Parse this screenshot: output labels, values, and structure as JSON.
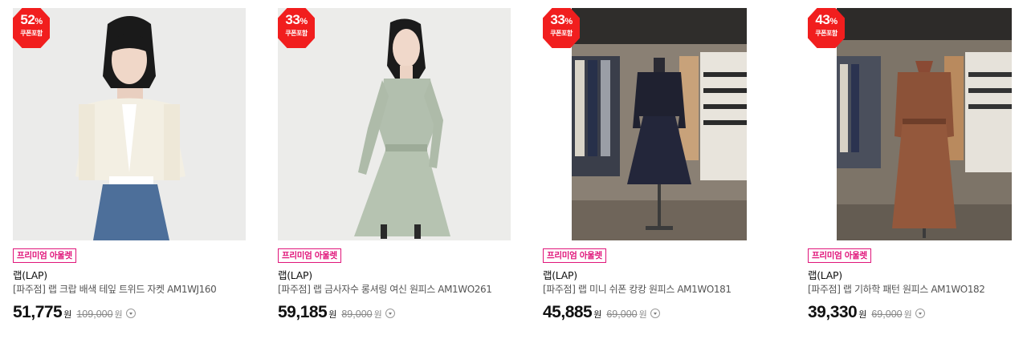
{
  "products": [
    {
      "discount_pct": "52",
      "discount_unit": "%",
      "coupon_label": "쿠폰포함",
      "badge": "프리미엄 아울렛",
      "brand": "랩(LAP)",
      "name": "[파주점] 랩 크랍 배색 테잎 트위드 자켓 AM1WJ160",
      "price": "51,775",
      "currency": "원",
      "original_price": "109,000",
      "original_currency": "원"
    },
    {
      "discount_pct": "33",
      "discount_unit": "%",
      "coupon_label": "쿠폰포함",
      "badge": "프리미엄 아울렛",
      "brand": "랩(LAP)",
      "name": "[파주점] 랩 금사자수 롱셔링 여신 원피스 AM1WO261",
      "price": "59,185",
      "currency": "원",
      "original_price": "89,000",
      "original_currency": "원"
    },
    {
      "discount_pct": "33",
      "discount_unit": "%",
      "coupon_label": "쿠폰포함",
      "badge": "프리미엄 아울렛",
      "brand": "랩(LAP)",
      "name": "[파주점] 랩 미니 쉬폰 캉캉 원피스 AM1WO181",
      "price": "45,885",
      "currency": "원",
      "original_price": "69,000",
      "original_currency": "원"
    },
    {
      "discount_pct": "43",
      "discount_unit": "%",
      "coupon_label": "쿠폰포함",
      "badge": "프리미엄 아울렛",
      "brand": "랩(LAP)",
      "name": "[파주점] 랩 기하학 패턴 원피스 AM1WO182",
      "price": "39,330",
      "currency": "원",
      "original_price": "69,000",
      "original_currency": "원"
    }
  ],
  "colors": {
    "discount_badge": "#f11e1e",
    "outlet_badge": "#e0157a"
  }
}
